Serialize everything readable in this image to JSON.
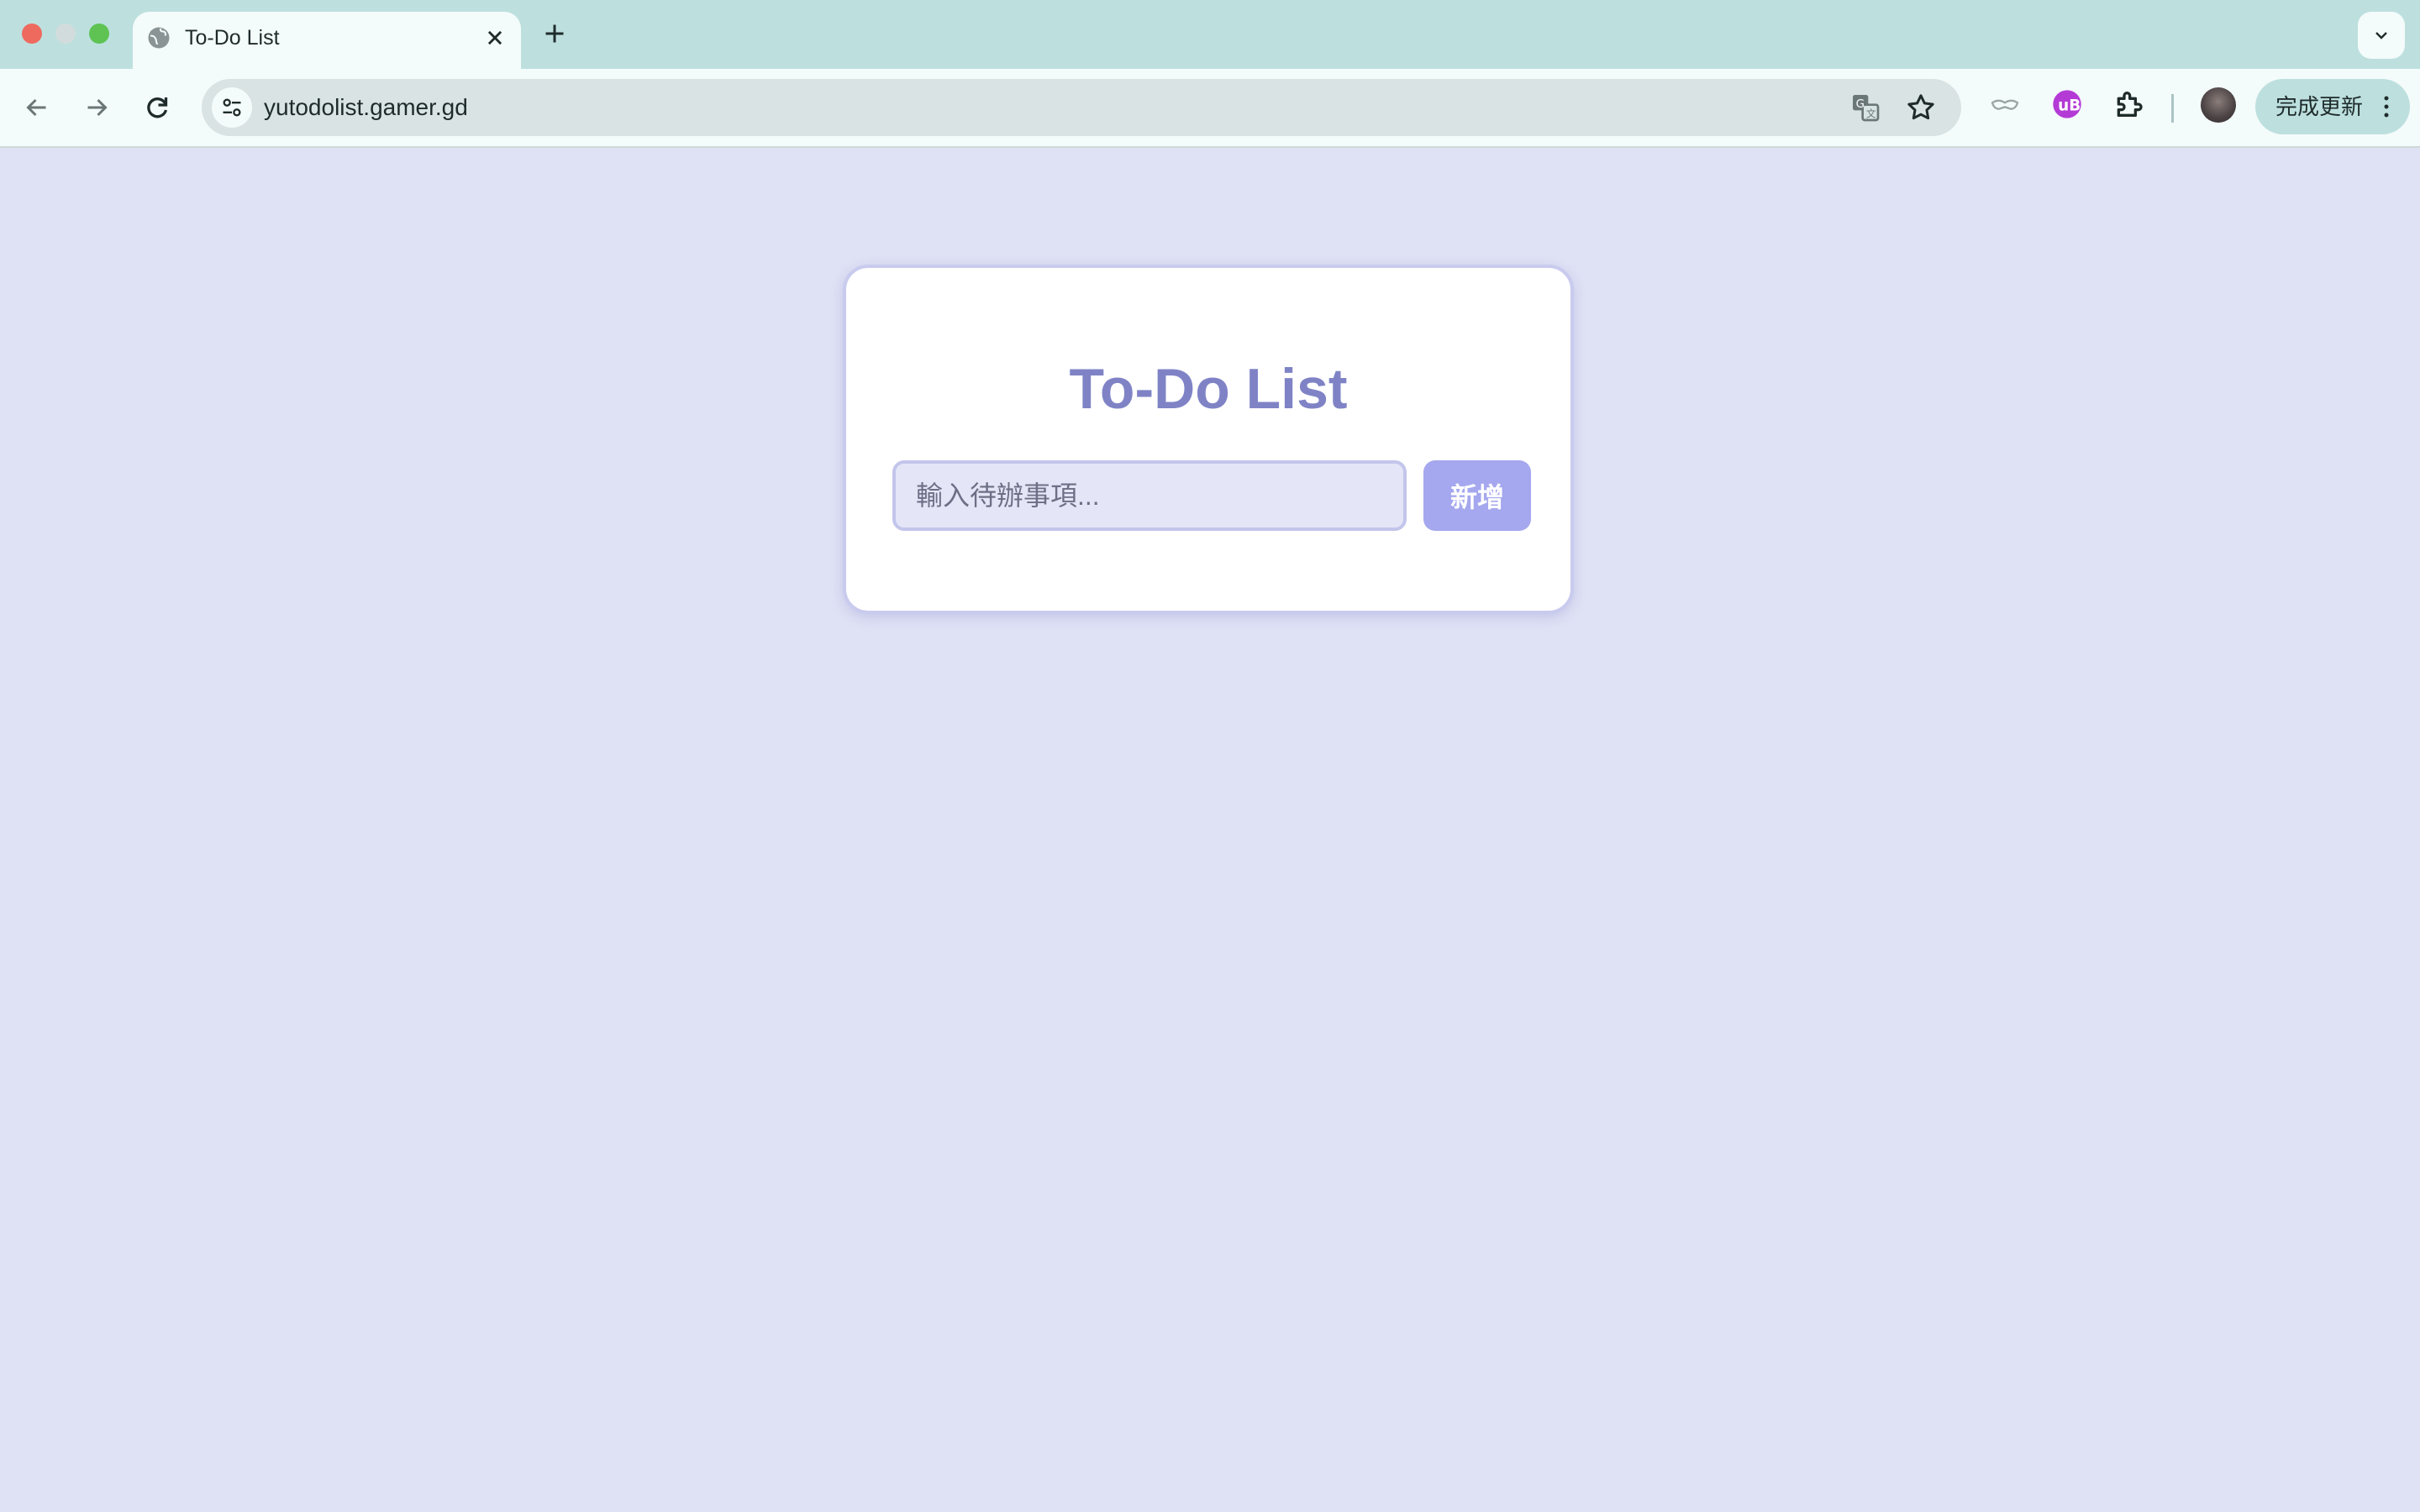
{
  "browser": {
    "tab": {
      "title": "To-Do List"
    },
    "address_bar": {
      "url": "yutodolist.gamer.gd"
    },
    "update_button": {
      "label": "完成更新"
    }
  },
  "icons": {
    "tab_favicon": "globe-icon",
    "tab_close": "close-icon",
    "new_tab": "plus-icon",
    "tab_search": "chevron-down-icon",
    "back": "arrow-left-icon",
    "forward": "arrow-right-icon",
    "reload": "reload-icon",
    "site_info": "tune-icon",
    "translate": "translate-icon",
    "bookmark": "star-icon",
    "extension_1": "mask-icon",
    "extension_2": "ublock-icon",
    "extensions": "puzzle-icon",
    "profile": "avatar",
    "menu": "more-vert-icon"
  },
  "app": {
    "title": "To-Do List",
    "input": {
      "placeholder": "輸入待辦事項...",
      "value": ""
    },
    "add_button": {
      "label": "新增"
    }
  },
  "colors": {
    "page_background": "#dfe1f5",
    "title": "#7f83c6",
    "button": "#a5a8ee",
    "input_background": "#e4e5f6",
    "tabstrip": "#bde0df"
  }
}
